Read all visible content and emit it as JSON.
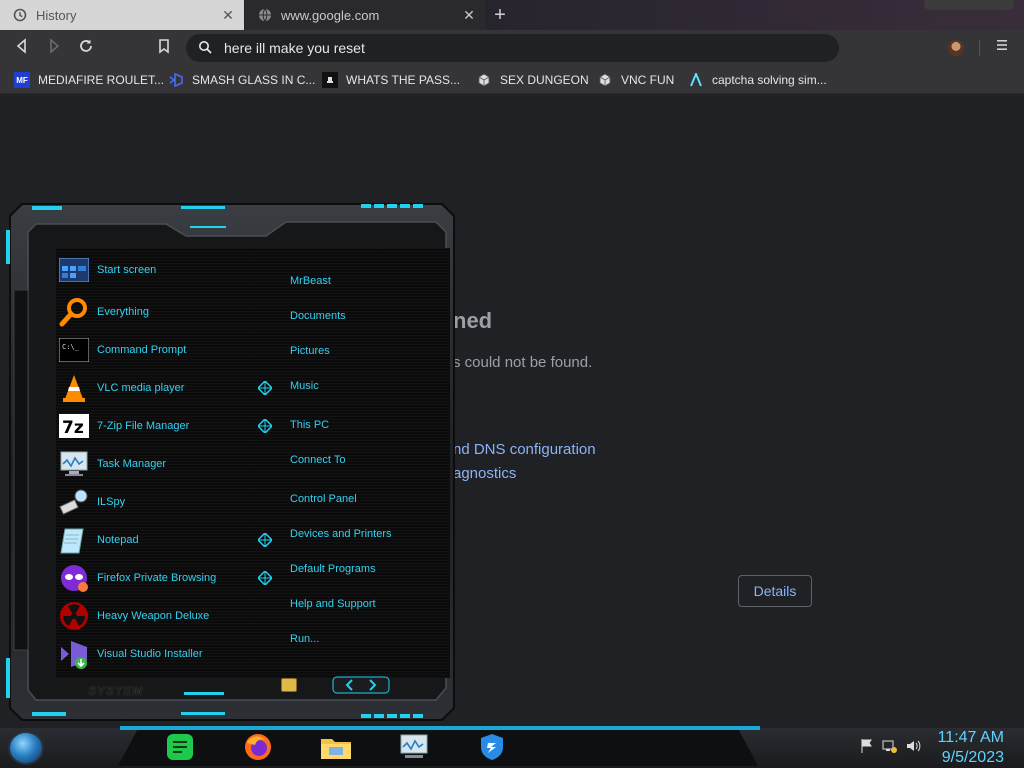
{
  "browser": {
    "tabs": [
      {
        "label": "History",
        "icon": "history-icon"
      },
      {
        "label": "www.google.com",
        "icon": "globe-icon"
      }
    ],
    "omnibox": {
      "value": "here ill make you reset"
    },
    "bookmarks": [
      {
        "label": "MEDIAFIRE ROULET...",
        "icon": "mediafire-icon",
        "color": "#1f3fd1"
      },
      {
        "label": "SMASH GLASS IN C...",
        "icon": "visual-studio-icon",
        "color": "#3d5afe"
      },
      {
        "label": "WHATS THE PASS...",
        "icon": "hat-icon",
        "color": "#111111"
      },
      {
        "label": "SEX DUNGEON",
        "icon": "cube-icon",
        "color": "#eeeeee"
      },
      {
        "label": "VNC FUN",
        "icon": "cube-icon",
        "color": "#eeeeee"
      },
      {
        "label": "captcha solving sim...",
        "icon": "arrow-a-icon",
        "color": "#5fe0ff"
      }
    ]
  },
  "error_page": {
    "title_fragment": "ned",
    "subtitle_fragment": "s could not be found.",
    "links": [
      "nd DNS configuration",
      "agnostics"
    ],
    "details_label": "Details"
  },
  "start_menu": {
    "apps": [
      {
        "label": "Start screen",
        "icon": "start-screen-icon"
      },
      {
        "label": "Everything",
        "icon": "magnifier-icon"
      },
      {
        "label": "Command Prompt",
        "icon": "cmd-icon"
      },
      {
        "label": "VLC media player",
        "icon": "vlc-cone-icon"
      },
      {
        "label": "7-Zip File Manager",
        "icon": "seven-zip-icon"
      },
      {
        "label": "Task Manager",
        "icon": "task-manager-icon"
      },
      {
        "label": "ILSpy",
        "icon": "ilspy-icon"
      },
      {
        "label": "Notepad",
        "icon": "notepad-icon"
      },
      {
        "label": "Firefox Private Browsing",
        "icon": "firefox-private-icon"
      },
      {
        "label": "Heavy Weapon Deluxe",
        "icon": "radiation-icon"
      },
      {
        "label": "Visual Studio Installer",
        "icon": "vs-installer-icon"
      }
    ],
    "places": [
      "MrBeast",
      "Documents",
      "Pictures",
      "Music",
      "This PC",
      "Connect To",
      "Control Panel",
      "Devices and Printers",
      "Default Programs",
      "Help and Support",
      "Run..."
    ],
    "system_label": "SYSTEM",
    "accent_color": "#1fd3f0"
  },
  "taskbar": {
    "pinned": [
      "notes-icon",
      "firefox-icon",
      "file-explorer-icon",
      "task-manager-icon",
      "shield-vpn-icon"
    ],
    "time": "11:47 AM",
    "date": "9/5/2023"
  }
}
